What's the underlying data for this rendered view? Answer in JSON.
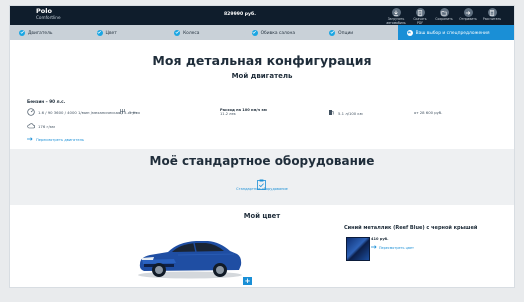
{
  "header": {
    "model": "Polo",
    "trim": "Comfortline",
    "price": "829990 руб.",
    "actions": [
      {
        "label": "Загрузить автомобиль",
        "icon": "download-icon"
      },
      {
        "label": "Скачать PDF",
        "icon": "pdf-icon"
      },
      {
        "label": "Сохранить",
        "icon": "save-icon"
      },
      {
        "label": "Отправить",
        "icon": "send-icon"
      },
      {
        "label": "Рассчитать",
        "icon": "calculator-icon"
      }
    ]
  },
  "steps": [
    {
      "label": "Двигатель"
    },
    {
      "label": "Цвет"
    },
    {
      "label": "Колеса"
    },
    {
      "label": "Обивка салона"
    },
    {
      "label": "Опции"
    },
    {
      "label": "Ваш выбор и спецпредложения"
    }
  ],
  "summary": {
    "title": "Моя детальная конфигурация",
    "engine_title": "Мой двигатель",
    "engine_name": "Бензин – 90 л.с.",
    "power": "1.6 / 90 3600 / 4000 1/мин /механическая / 5-ступ.",
    "gearbox": "5 Нех",
    "fuel_label": "Расход на 100 км/ч км",
    "fuel_value": "11.2 лек",
    "consumption": "5.1 л/100 км",
    "engine_price": "от 28 600 руб.",
    "emissions": "176 г/км",
    "change_engine": "Пересмотреть двигатель"
  },
  "equipment": {
    "title": "Моё стандартное оборудование",
    "link": "Стандартное оборудование"
  },
  "color": {
    "title": "Мой цвет",
    "name": "Синий металлик (Reef Blue) с черной крышей",
    "price": "410 руб.",
    "change": "Пересмотреть цвет",
    "swatch": "#1f4ea3"
  },
  "colors": {
    "accent": "#1a8fd6",
    "header_bg": "#0f1d2c",
    "steps_bg": "#c9d1d8"
  }
}
